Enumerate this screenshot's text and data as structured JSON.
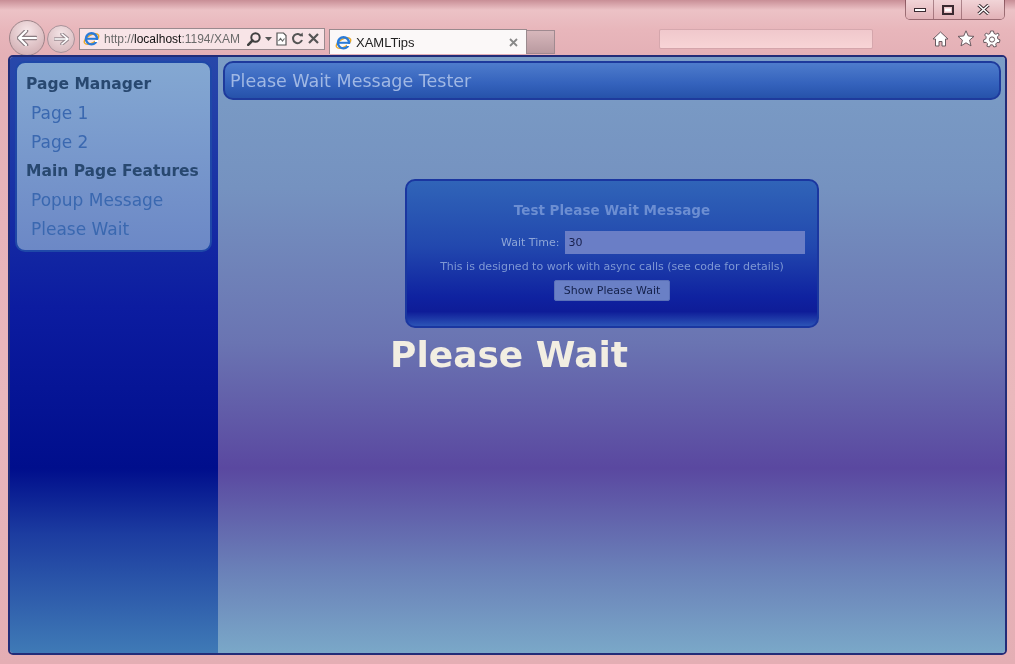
{
  "browser": {
    "address": {
      "scheme": "http://",
      "host": "localhost",
      "rest": ":1194/XAM"
    },
    "tabs": [
      {
        "title": "XAMLTips",
        "selected": true
      }
    ]
  },
  "sidebar": {
    "sections": [
      {
        "title": "Page Manager",
        "items": [
          "Page 1",
          "Page 2"
        ]
      },
      {
        "title": "Main Page Features",
        "items": [
          "Popup Message",
          "Please Wait"
        ]
      }
    ]
  },
  "header": {
    "title": "Please Wait Message Tester"
  },
  "dialog": {
    "title": "Test Please Wait Message",
    "field": {
      "label": "Wait Time:",
      "value": "30"
    },
    "note": "This is designed to work with async calls (see code for details)",
    "button": "Show Please Wait"
  },
  "overlay": {
    "message": "Please Wait"
  }
}
